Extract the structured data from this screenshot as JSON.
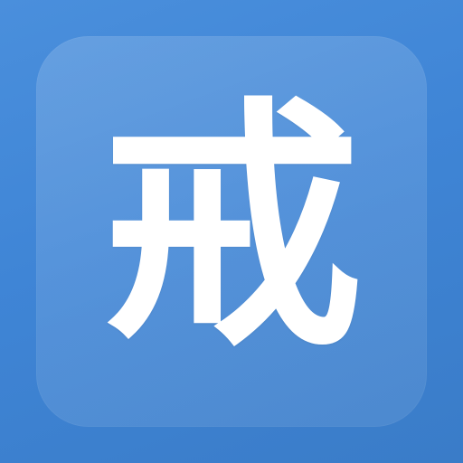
{
  "icon": {
    "glyph": "戒",
    "colors": {
      "background": "#3f85d6",
      "tile": "#5c9ae0",
      "glyph": "#ffffff"
    }
  }
}
